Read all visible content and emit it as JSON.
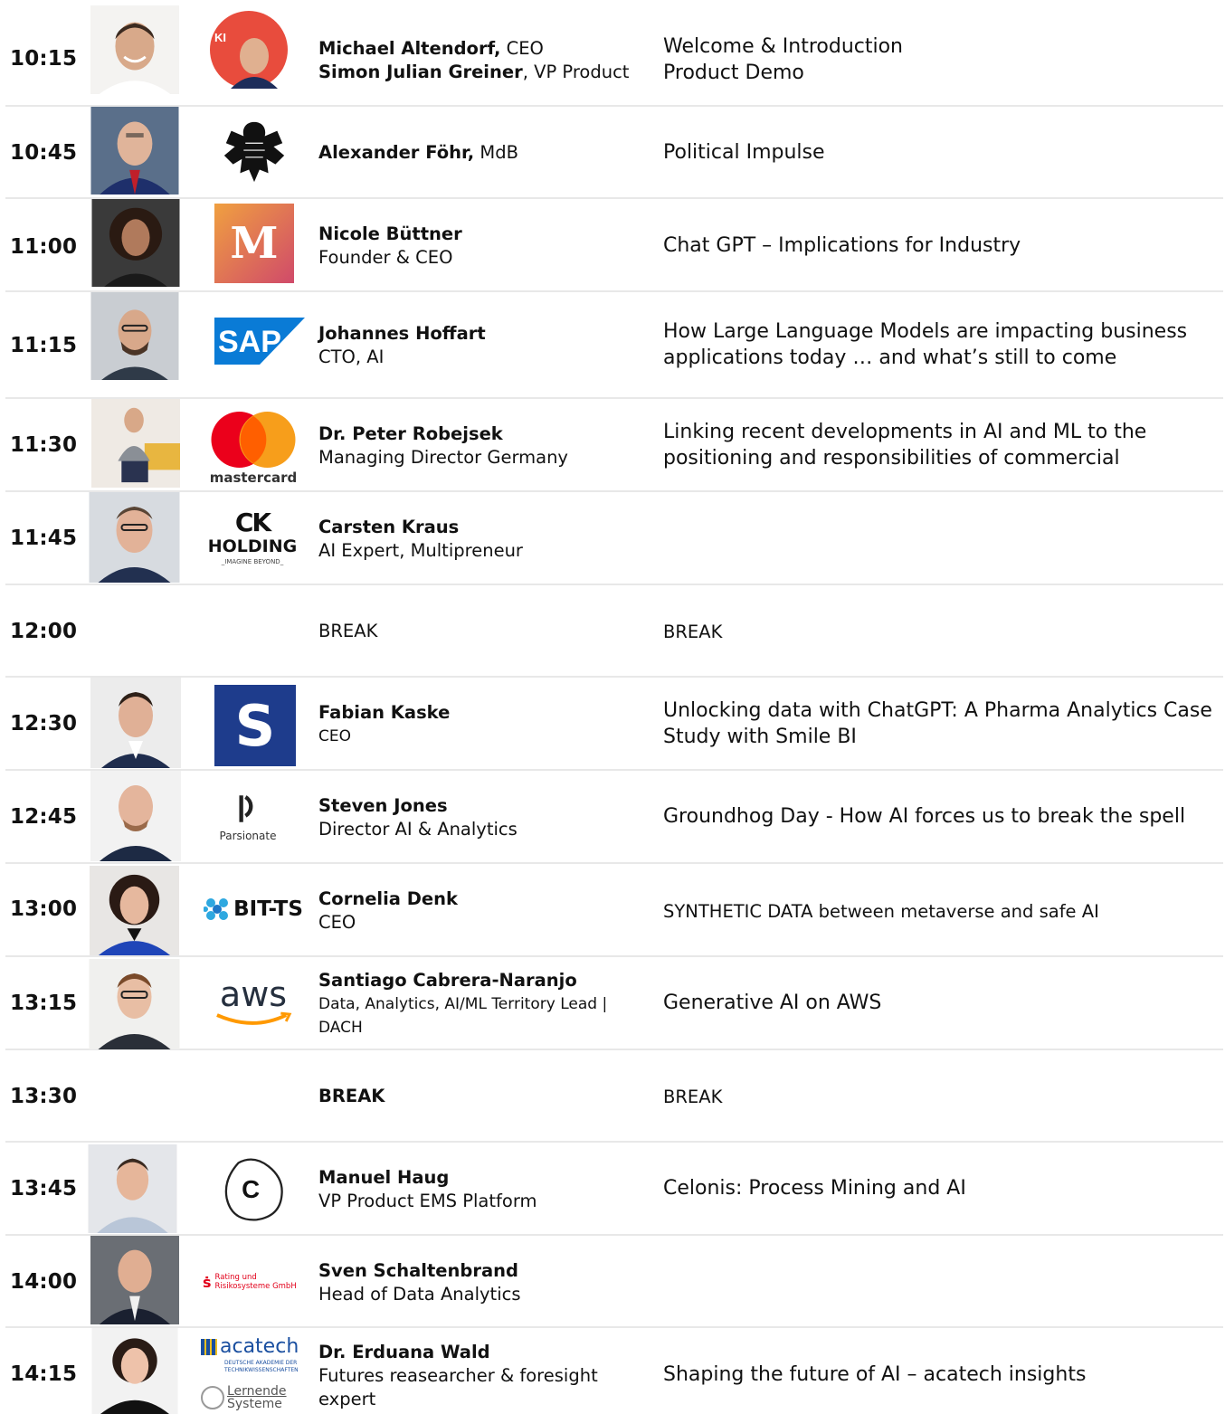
{
  "colors": {
    "divider": "#e8e8e8",
    "text": "#111111"
  },
  "rows": [
    {
      "time": "10:15",
      "speakers": [
        {
          "name": "Michael Altendorf,",
          "role": " CEO"
        },
        {
          "name": "Simon Julian Greiner",
          "role": ", VP Product"
        }
      ],
      "topic": [
        "Welcome & Introduction",
        "Product Demo"
      ]
    },
    {
      "time": "10:45",
      "speakers": [
        {
          "name": "Alexander Föhr,",
          "role": " MdB"
        }
      ],
      "topic": [
        "Political Impulse"
      ]
    },
    {
      "time": "11:00",
      "name": "Nicole Büttner",
      "role": "Founder  & CEO",
      "topic": [
        "Chat GPT – Implications for Industry"
      ],
      "logo_text": "M"
    },
    {
      "time": "11:15",
      "name": "Johannes Hoffart",
      "role": "CTO, AI",
      "topic": [
        "How Large Language Models are impacting business",
        "applications today … and what’s still to come"
      ],
      "logo_text": "SAP"
    },
    {
      "time": "11:30",
      "name": "Dr. Peter Robejsek",
      "role": "Managing Director Germany",
      "topic": [
        "Linking recent developments in AI and ML to the",
        "positioning and responsibilities of commercial"
      ],
      "logo_text": "mastercard"
    },
    {
      "time": "11:45",
      "name": "Carsten Kraus",
      "role": "AI Expert, Multipreneur",
      "topic": [],
      "logo_text": [
        "CK",
        "HOLDING",
        "_IMAGINE BEYOND_"
      ]
    },
    {
      "time": "12:00",
      "speaker_plain": "BREAK",
      "topic_plain": "BREAK"
    },
    {
      "time": "12:30",
      "name": "Fabian Kaske",
      "role": "CEO",
      "topic": [
        "Unlocking data with ChatGPT: A Pharma Analytics Case",
        "Study with Smile BI"
      ],
      "logo_text": "S"
    },
    {
      "time": "12:45",
      "name": "Steven Jones",
      "role": "Director AI & Analytics",
      "topic": [
        "Groundhog Day - How AI forces us to break the spell"
      ],
      "logo_text": "Parsionate"
    },
    {
      "time": "13:00",
      "name": "Cornelia Denk",
      "role": "CEO",
      "topic": [
        "SYNTHETIC DATA between  metaverse  and safe AI"
      ],
      "logo_text": "BIT-TS"
    },
    {
      "time": "13:15",
      "name": "Santiago Cabrera-Naranjo",
      "role": [
        "Data, Analytics, AI/ML Territory Lead  |",
        "DACH"
      ],
      "topic": [
        "Generative AI on AWS"
      ],
      "logo_text": "aws"
    },
    {
      "time": "13:30",
      "speaker_bold": "BREAK",
      "topic_plain": "BREAK"
    },
    {
      "time": "13:45",
      "name": "Manuel Haug",
      "role": "VP Product EMS Platform",
      "topic": [
        "Celonis: Process Mining and AI"
      ],
      "logo_text": "C"
    },
    {
      "time": "14:00",
      "name": "Sven Schaltenbrand",
      "role": "Head of Data Analytics",
      "topic": [],
      "logo_text": [
        "Rating und",
        "Risikosysteme GmbH"
      ]
    },
    {
      "time": "14:15",
      "name": "Dr. Erduana Wald",
      "role": [
        "Futures reasearcher  & foresight",
        "expert"
      ],
      "topic": [
        "Shaping the future of AI – acatech insights"
      ],
      "logo_text": [
        "acatech",
        "DEUTSCHE AKADEMIE DER",
        "TECHNIKWISSENSCHAFTEN",
        "Lernende",
        "Systeme"
      ]
    }
  ]
}
